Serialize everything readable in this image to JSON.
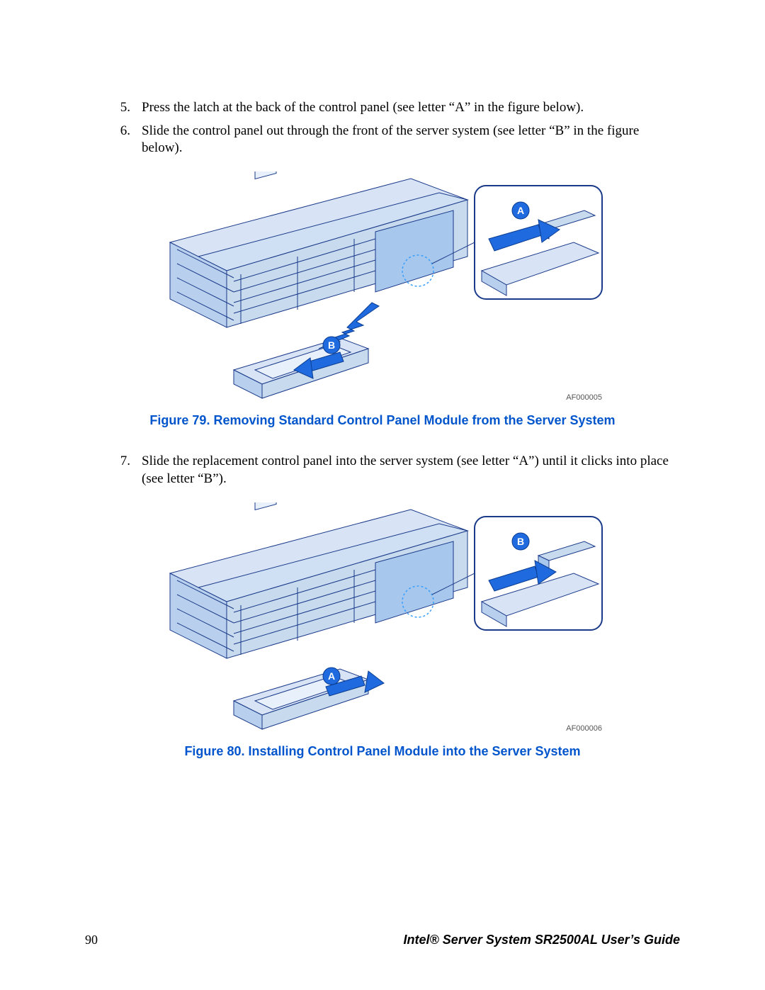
{
  "steps": [
    {
      "num": "5.",
      "text": "Press the latch at the back of the control panel (see letter “A” in the figure below)."
    },
    {
      "num": "6.",
      "text": "Slide the control panel out through the front of the server system (see letter “B” in the figure below)."
    },
    {
      "num": "7.",
      "text": "Slide the replacement control panel into the server system (see letter “A”) until it clicks into place (see letter “B”)."
    }
  ],
  "figures": [
    {
      "caption": "Figure 79. Removing Standard Control Panel Module from the Server System",
      "label": "AF000005",
      "callouts": {
        "a": "A",
        "b": "B"
      }
    },
    {
      "caption": "Figure 80. Installing Control Panel Module into the Server System",
      "label": "AF000006",
      "callouts": {
        "a": "A",
        "b": "B"
      }
    }
  ],
  "footer": {
    "page": "90",
    "title": "Intel® Server System SR2500AL User’s Guide"
  }
}
